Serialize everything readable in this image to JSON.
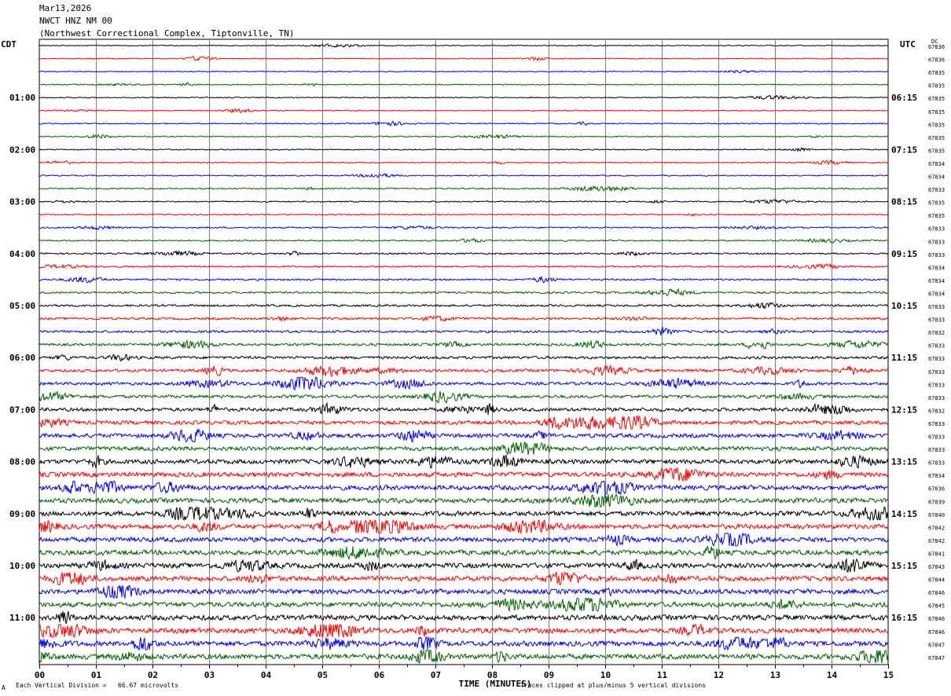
{
  "header": {
    "date": "Mar13,2026",
    "station": "NWCT HNZ NM 00",
    "location": "(Northwest Correctional Complex, Tiptonville, TN)"
  },
  "left_axis_label": "CDT",
  "right_axis_label": "UTC",
  "dc_label": "DC",
  "footer": {
    "scale": "Each Vertical Division =   66.67 microvolts",
    "clip": "Traces clipped at plus/minus 5 vertical divisions",
    "corner_mark": "A"
  },
  "chart_data": {
    "type": "line",
    "title": "",
    "xlabel": "TIME (MINUTES)",
    "xlim": [
      0,
      15
    ],
    "x_ticks": [
      "00",
      "01",
      "02",
      "03",
      "04",
      "05",
      "06",
      "07",
      "08",
      "09",
      "10",
      "11",
      "12",
      "13",
      "14",
      "15"
    ],
    "trace_colors": [
      "#000000",
      "#ff0000",
      "#0000ff",
      "#006400"
    ],
    "left_time_labels": [
      "01:00",
      "02:00",
      "03:00",
      "04:00",
      "05:00",
      "06:00",
      "07:00",
      "08:00",
      "09:00",
      "10:00",
      "11:00"
    ],
    "right_time_labels": [
      "06:15",
      "07:15",
      "08:15",
      "09:15",
      "10:15",
      "11:15",
      "12:15",
      "13:15",
      "14:15",
      "15:15",
      "16:15"
    ],
    "time_label_every_n_traces": 4,
    "time_label_first_trace": 4,
    "dc_offsets": [
      "67836",
      "67836",
      "67835",
      "67835",
      "67835",
      "67835",
      "67835",
      "67835",
      "67835",
      "67834",
      "67834",
      "67833",
      "67835",
      "67835",
      "67833",
      "67833",
      "67833",
      "67834",
      "67834",
      "67834",
      "67833",
      "67833",
      "67832",
      "67833",
      "67833",
      "67833",
      "67833",
      "67833",
      "67832",
      "67833",
      "67833",
      "67833",
      "67833",
      "67834",
      "67836",
      "67839",
      "67840",
      "67842",
      "67842",
      "67841",
      "67843",
      "67844",
      "67846",
      "67845",
      "67846",
      "67846",
      "67847",
      "67847"
    ],
    "trace_activity": [
      0.6,
      0.6,
      0.6,
      0.6,
      0.6,
      0.6,
      0.7,
      0.7,
      0.7,
      0.7,
      0.7,
      0.8,
      0.8,
      0.8,
      0.9,
      0.9,
      1.0,
      1.0,
      1.1,
      1.2,
      1.3,
      1.4,
      1.5,
      1.6,
      1.7,
      1.8,
      1.9,
      2.0,
      2.2,
      2.4,
      2.6,
      2.6,
      2.8,
      2.9,
      3.0,
      3.0,
      3.0,
      3.0,
      3.0,
      3.1,
      3.1,
      3.1,
      3.1,
      3.1,
      3.2,
      3.2,
      3.2,
      3.2
    ]
  }
}
